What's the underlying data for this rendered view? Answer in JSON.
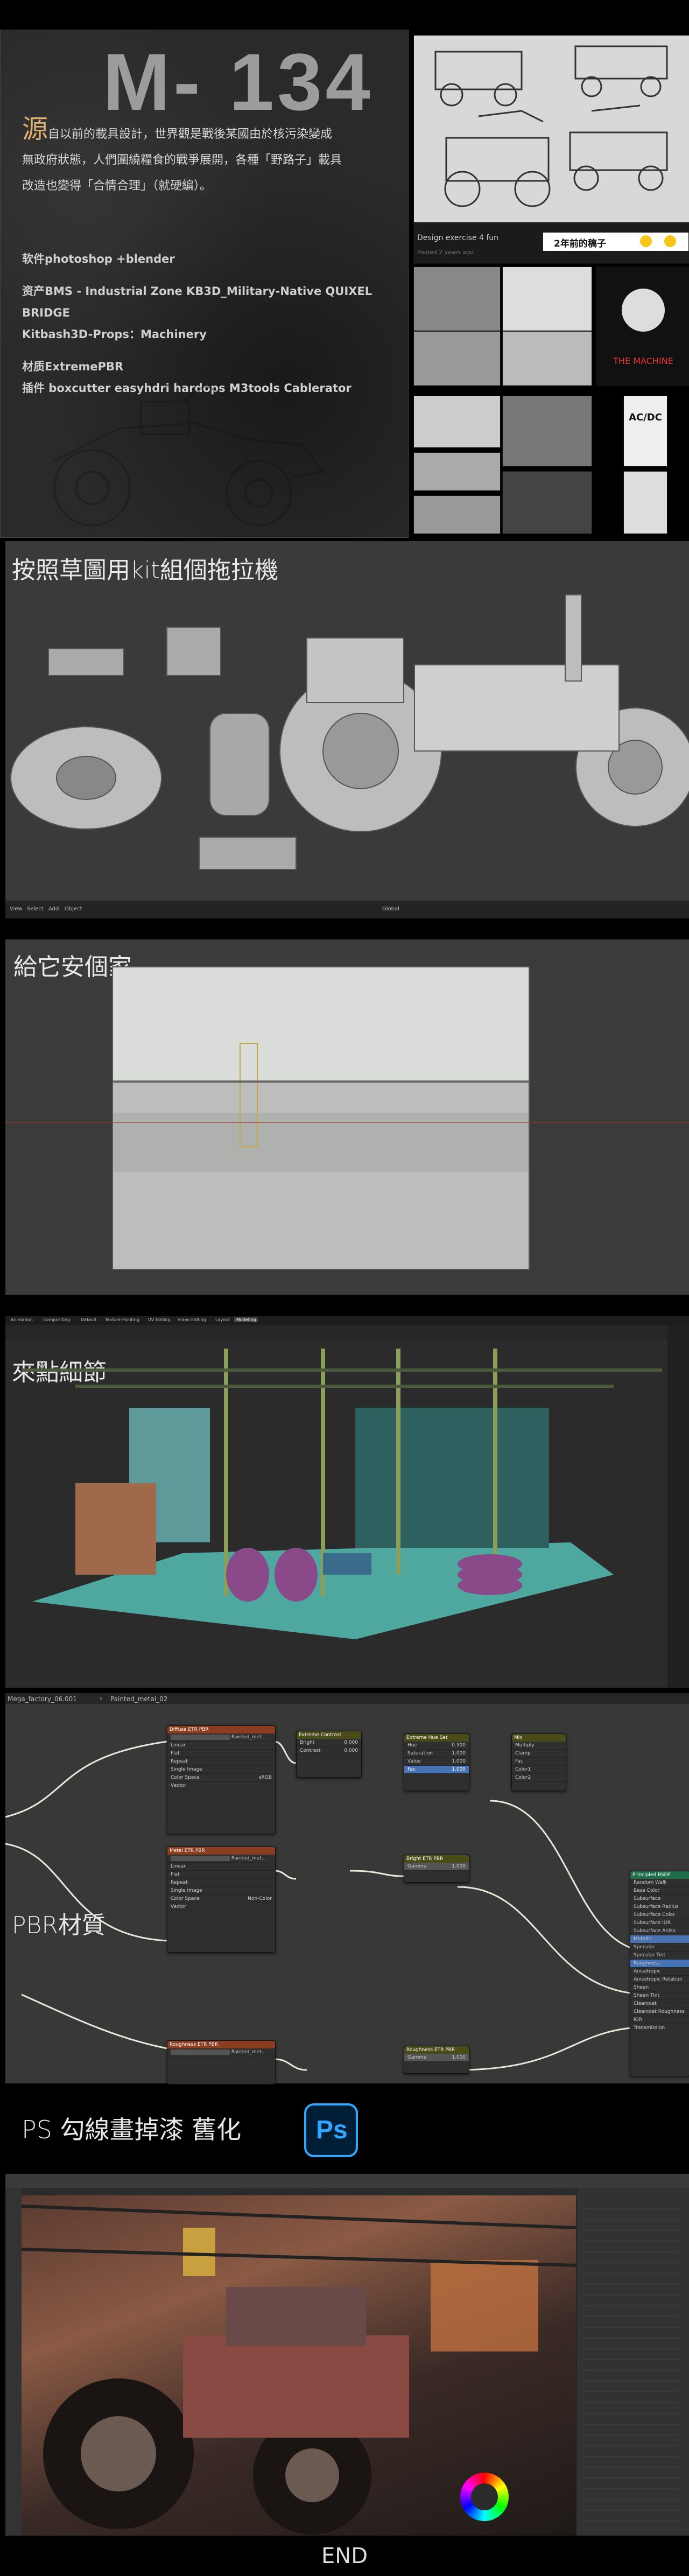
{
  "header": {
    "title": "M- 134",
    "desc_lead": "源",
    "desc_line1": "自以前的載具設計，世界觀是戰後某國由於核污染變成",
    "desc_line2": "無政府狀態，人們圍繞糧食的戰爭展開，各種「野路子」載具",
    "desc_line3": "改造也變得「合情合理」（就硬編）。",
    "software": "软件photoshop +blender",
    "assets_line1": "资产BMS - Industrial Zone  KB3D_Military-Native  QUIXEL BRIDGE",
    "assets_line2": "Kitbash3D-Props：Machinery",
    "material": "材质ExtremePBR",
    "plugins": "插件 boxcutter easyhdri hardops M3tools Cablerator"
  },
  "post": {
    "caption": "Design exercise 4 fun",
    "time": "Posted 2 years ago",
    "badge": "2年前的稿子"
  },
  "sections": {
    "kit": "按照草圖用kit組個拖拉機",
    "uv": "給它安個家",
    "detail": "來點細節",
    "pbr": "PBR材質",
    "ps": "PS 勾線畫掉漆 舊化",
    "ps_logo": "Ps",
    "end": "END"
  },
  "blender": {
    "menu": [
      "View",
      "Select",
      "Add",
      "Object"
    ],
    "mode": "Global",
    "tabs": [
      "Animation",
      "Compositing",
      "Default",
      "Texture Painting",
      "UV Editing",
      "Video Editing",
      "Layout",
      "Modeling"
    ],
    "breadcrumb_file": "Mega_factory_06.001",
    "breadcrumb_mat": "Painted_metal_02",
    "shading_tab": "Shading"
  },
  "nodes": {
    "diffuse": {
      "title": "Diffuse ETR PBR",
      "file": "Painted_met...",
      "interp": "Linear",
      "proj": "Flat",
      "ext": "Repeat",
      "src": "Single Image",
      "cs_label": "Color Space",
      "cs": "sRGB",
      "vec": "Vector"
    },
    "rough": {
      "title": "Metal ETR PBR",
      "file": "Painted_met...",
      "interp": "Linear",
      "proj": "Flat",
      "ext": "Repeat",
      "src": "Single Image",
      "cs_label": "Color Space",
      "cs": "Non-Color",
      "vec": "Vector"
    },
    "bc": {
      "title": "Extreme Contrast",
      "bright": "Bright",
      "contrast": "Contrast",
      "b_val": "0.000",
      "c_val": "0.000"
    },
    "hsv": {
      "title": "Extreme Hue Sat",
      "hue": "Hue",
      "sat": "Saturation",
      "val": "Value",
      "fac": "Fac",
      "h": "0.500",
      "s": "1.000",
      "v": "1.000",
      "f": "1.000"
    },
    "mix": {
      "title": "Mix",
      "clamp": "Clamp",
      "fac": "Fac",
      "col1": "Color1",
      "col2": "Color2",
      "mode": "Multiply"
    },
    "gamma": {
      "title": "Bright ETR PBR",
      "label": "Gamma",
      "val": "1.000"
    },
    "bsdf": {
      "title": "Principled BSDF",
      "rows": [
        "Random Walk",
        "Base Color",
        "Subsurface",
        "Subsurface Radius",
        "Subsurface Color",
        "Subsurface IOR",
        "Subsurface Aniso",
        "Metallic",
        "Specular",
        "Specular Tint",
        "Roughness",
        "Anisotropic",
        "Anisotropic Rotation",
        "Sheen",
        "Sheen Tint",
        "Clearcoat",
        "Clearcoat Roughness",
        "IOR",
        "Transmission"
      ]
    },
    "rough2": {
      "title": "Roughness ETR PBR",
      "file": "Painted_met..."
    },
    "gamma2": {
      "title": "Roughness ETR PBR",
      "label": "Gamma",
      "val": "1.000"
    }
  },
  "moodboard_labels": [
    "AC/DC",
    "THE MACHINE"
  ],
  "colors": {
    "bg": "#000000",
    "panel": "#2a2a2a",
    "ps_blue": "#31a8ff",
    "ps_dark": "#001e36",
    "node_tex": "#8a3d1f",
    "node_color": "#4b4b17",
    "node_shader": "#1f6e4a"
  }
}
